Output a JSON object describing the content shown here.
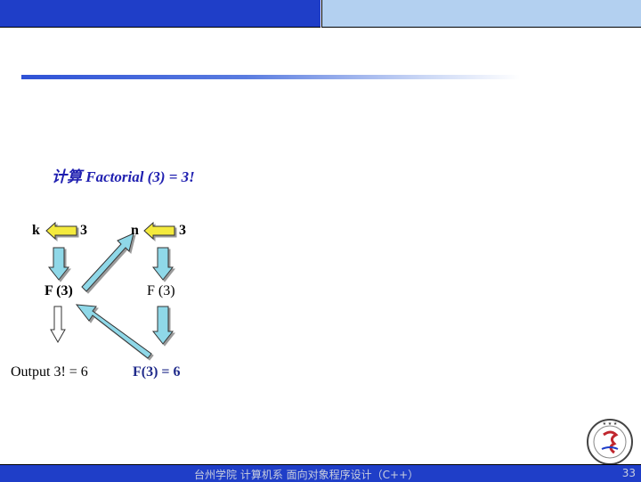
{
  "slide": {
    "heading": "计算  Factorial (3) = 3!"
  },
  "diagram": {
    "left": {
      "var_label": "k",
      "arg_value": "3",
      "call_label": "F (3)",
      "output_label": "Output  3! = 6"
    },
    "right": {
      "param_label": "n",
      "arg_value": "3",
      "call_label": "F (3)",
      "result_label": "F(3) = 6"
    }
  },
  "footer": {
    "text": "台州学院 计算机系 面向对象程序设计（C++）",
    "page_number": "33"
  },
  "colors": {
    "brand_blue": "#1f3ec8",
    "light_blue": "#b3d0f0",
    "arrow_fill": "#8fd8e8",
    "arrow_left_fill": "#f4ea3c"
  }
}
